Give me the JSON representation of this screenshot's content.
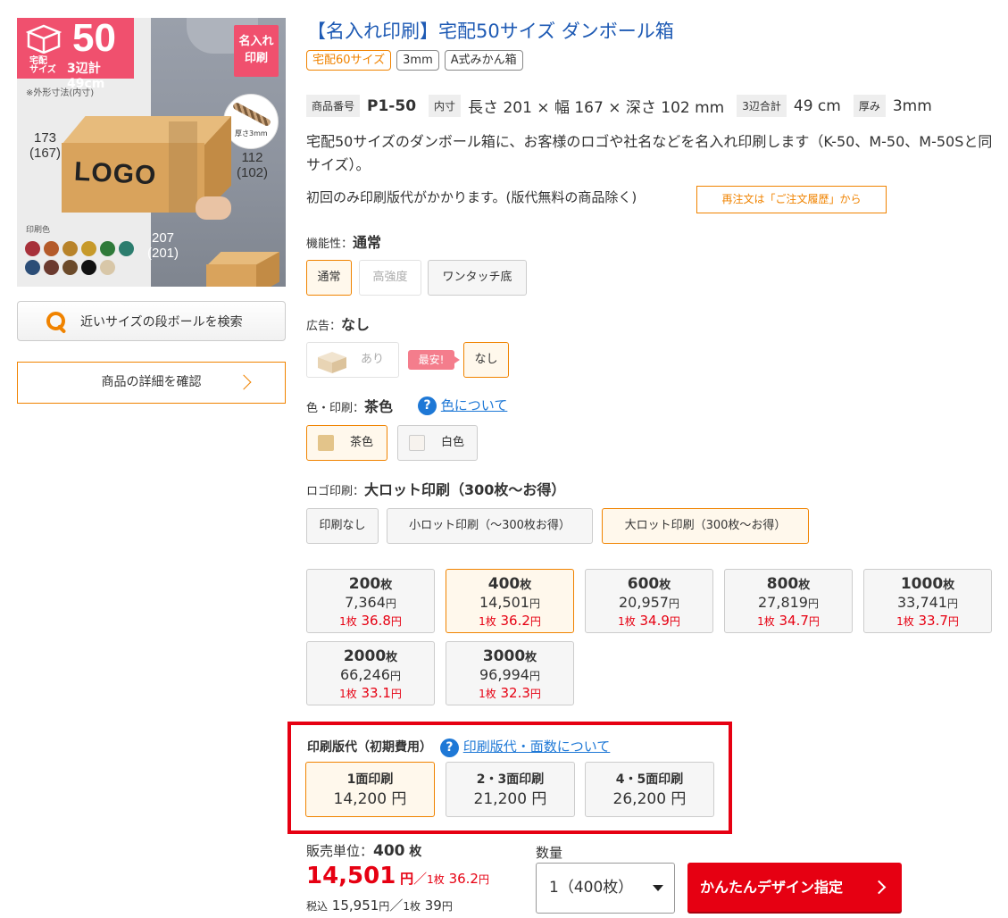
{
  "image": {
    "size_number": "50",
    "size_caption_1": "宅配",
    "size_caption_2": "サイズ",
    "size_sum": "3辺計49cm",
    "name_badge_1": "名入れ",
    "name_badge_2": "印刷",
    "dim_note": "※外形寸法(内寸)",
    "thickness_label": "厚さ3mm",
    "dim_left_1": "173",
    "dim_left_2": "(167)",
    "dim_right_1": "112",
    "dim_right_2": "(102)",
    "dim_bottom_1": "207",
    "dim_bottom_2": "(201)",
    "logo_text": "LOGO",
    "print_color_label": "印刷色",
    "swatch_colors": [
      "#a7303a",
      "#b45a2a",
      "#b8832a",
      "#c79a2a",
      "#2f7a3a",
      "#2c7d6e",
      "#2b4d77",
      "#6b3a2f",
      "#6b4a2a",
      "#111111",
      "#d8c7a8"
    ]
  },
  "left": {
    "search_button": "近いサイズの段ボールを検索",
    "detail_button": "商品の詳細を確認"
  },
  "product": {
    "title": "【名入れ印刷】宅配50サイズ ダンボール箱",
    "tags": [
      "宅配60サイズ",
      "3mm",
      "A式みかん箱"
    ],
    "spec": {
      "code_key": "商品番号",
      "code_val": "P1-50",
      "inner_key": "内寸",
      "inner_val": "長さ 201 × 幅 167 × 深さ 102 mm",
      "sum_key": "3辺合計",
      "sum_val": "49 cm",
      "thick_key": "厚み",
      "thick_val": "3mm"
    },
    "description": "宅配50サイズのダンボール箱に、お客様のロゴや社名などを名入れ印刷します（K-50、M-50、M-50Sと同サイズ）。",
    "note": "初回のみ印刷版代がかかります。(版代無料の商品除く)",
    "reorder_button": "再注文は「ご注文履歴」から"
  },
  "options": {
    "function": {
      "label": "機能性：",
      "value": "通常",
      "choices": [
        "通常",
        "高強度",
        "ワンタッチ底"
      ]
    },
    "ad": {
      "label": "広告：",
      "value": "なし",
      "choices": [
        "あり",
        "なし"
      ],
      "badge": "最安!"
    },
    "color": {
      "label": "色・印刷：",
      "value": "茶色",
      "help_link": "色について",
      "choices": [
        "茶色",
        "白色"
      ]
    },
    "logo_print": {
      "label": "ロゴ印刷：",
      "value": "大ロット印刷（300枚～お得）",
      "choices": [
        "印刷なし",
        "小ロット印刷（～300枚お得）",
        "大ロット印刷（300枚～お得）"
      ]
    }
  },
  "quantities": [
    {
      "qty": "200",
      "price": "7,364",
      "unit": "36.8"
    },
    {
      "qty": "400",
      "price": "14,501",
      "unit": "36.2"
    },
    {
      "qty": "600",
      "price": "20,957",
      "unit": "34.9"
    },
    {
      "qty": "800",
      "price": "27,819",
      "unit": "34.7"
    },
    {
      "qty": "1000",
      "price": "33,741",
      "unit": "33.7"
    },
    {
      "qty": "2000",
      "price": "66,246",
      "unit": "33.1"
    },
    {
      "qty": "3000",
      "price": "96,994",
      "unit": "32.3"
    }
  ],
  "qty_labels": {
    "sheet": "枚",
    "yen": "円",
    "per_one": "1枚"
  },
  "plate": {
    "label": "印刷版代（初期費用）",
    "help_link": "印刷版代・面数について",
    "choices": [
      {
        "name": "1面印刷",
        "price": "14,200 円"
      },
      {
        "name": "2・3面印刷",
        "price": "21,200 円"
      },
      {
        "name": "4・5面印刷",
        "price": "26,200 円"
      }
    ]
  },
  "purchase": {
    "unit_label": "販売単位：",
    "unit_value": "400",
    "unit_suffix": "枚",
    "price": "14,501",
    "price_yen": "円",
    "per_label": "／",
    "per_prefix": "1枚",
    "per_value": "36.2",
    "per_yen": "円",
    "tax_label": "税込",
    "tax_price": "15,951",
    "tax_yen": "円",
    "tax_per": "／",
    "tax_per_prefix": "1枚",
    "tax_per_value": "39",
    "tax_per_yen": "円",
    "qty_label": "数量",
    "qty_selected": "1（400枚）",
    "design_button": "かんたんデザイン指定"
  },
  "colors": {
    "accent_orange": "#f08300",
    "price_red": "#e60012",
    "link_blue": "#1e78d6",
    "badge_pink": "#f0506e"
  }
}
